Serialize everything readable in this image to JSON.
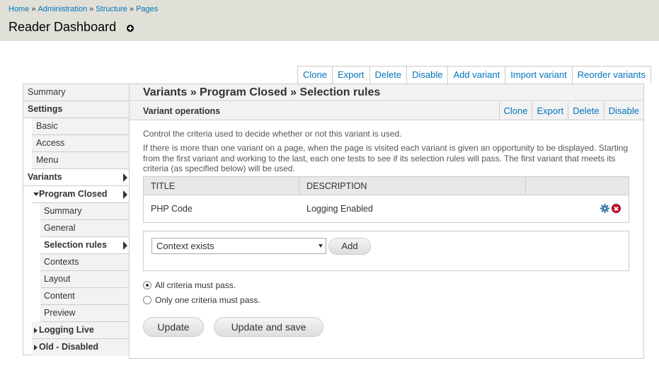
{
  "breadcrumb": {
    "items": [
      "Home",
      "Administration",
      "Structure",
      "Pages"
    ],
    "separator": "»"
  },
  "page": {
    "title": "Reader Dashboard"
  },
  "top_actions": [
    "Clone",
    "Export",
    "Delete",
    "Disable",
    "Add variant",
    "Import variant",
    "Reorder variants"
  ],
  "sidebar": {
    "summary": "Summary",
    "settings": "Settings",
    "basic": "Basic",
    "access": "Access",
    "menu": "Menu",
    "variants": "Variants",
    "program_closed": "Program Closed",
    "pc_summary": "Summary",
    "pc_general": "General",
    "pc_selection_rules": "Selection rules",
    "pc_contexts": "Contexts",
    "pc_layout": "Layout",
    "pc_content": "Content",
    "pc_preview": "Preview",
    "logging_live": "Logging Live",
    "old_disabled": "Old - Disabled"
  },
  "main": {
    "title": "Variants » Program Closed » Selection rules",
    "ops_title": "Variant operations",
    "ops_actions": [
      "Clone",
      "Export",
      "Delete",
      "Disable"
    ],
    "desc1": "Control the criteria used to decide whether or not this variant is used.",
    "desc2": "If there is more than one variant on a page, when the page is visited each variant is given an opportunity to be displayed. Starting from the first variant and working to the last, each one tests to see if its selection rules will pass. The first variant that meets its criteria (as specified below) will be used.",
    "table": {
      "headers": [
        "TITLE",
        "DESCRIPTION"
      ],
      "rows": [
        {
          "title": "PHP Code",
          "description": "Logging Enabled"
        }
      ]
    },
    "criteria_select": "Context exists",
    "add_label": "Add",
    "radio_all": "All criteria must pass.",
    "radio_one": "Only one criteria must pass.",
    "update_label": "Update",
    "update_save_label": "Update and save"
  }
}
